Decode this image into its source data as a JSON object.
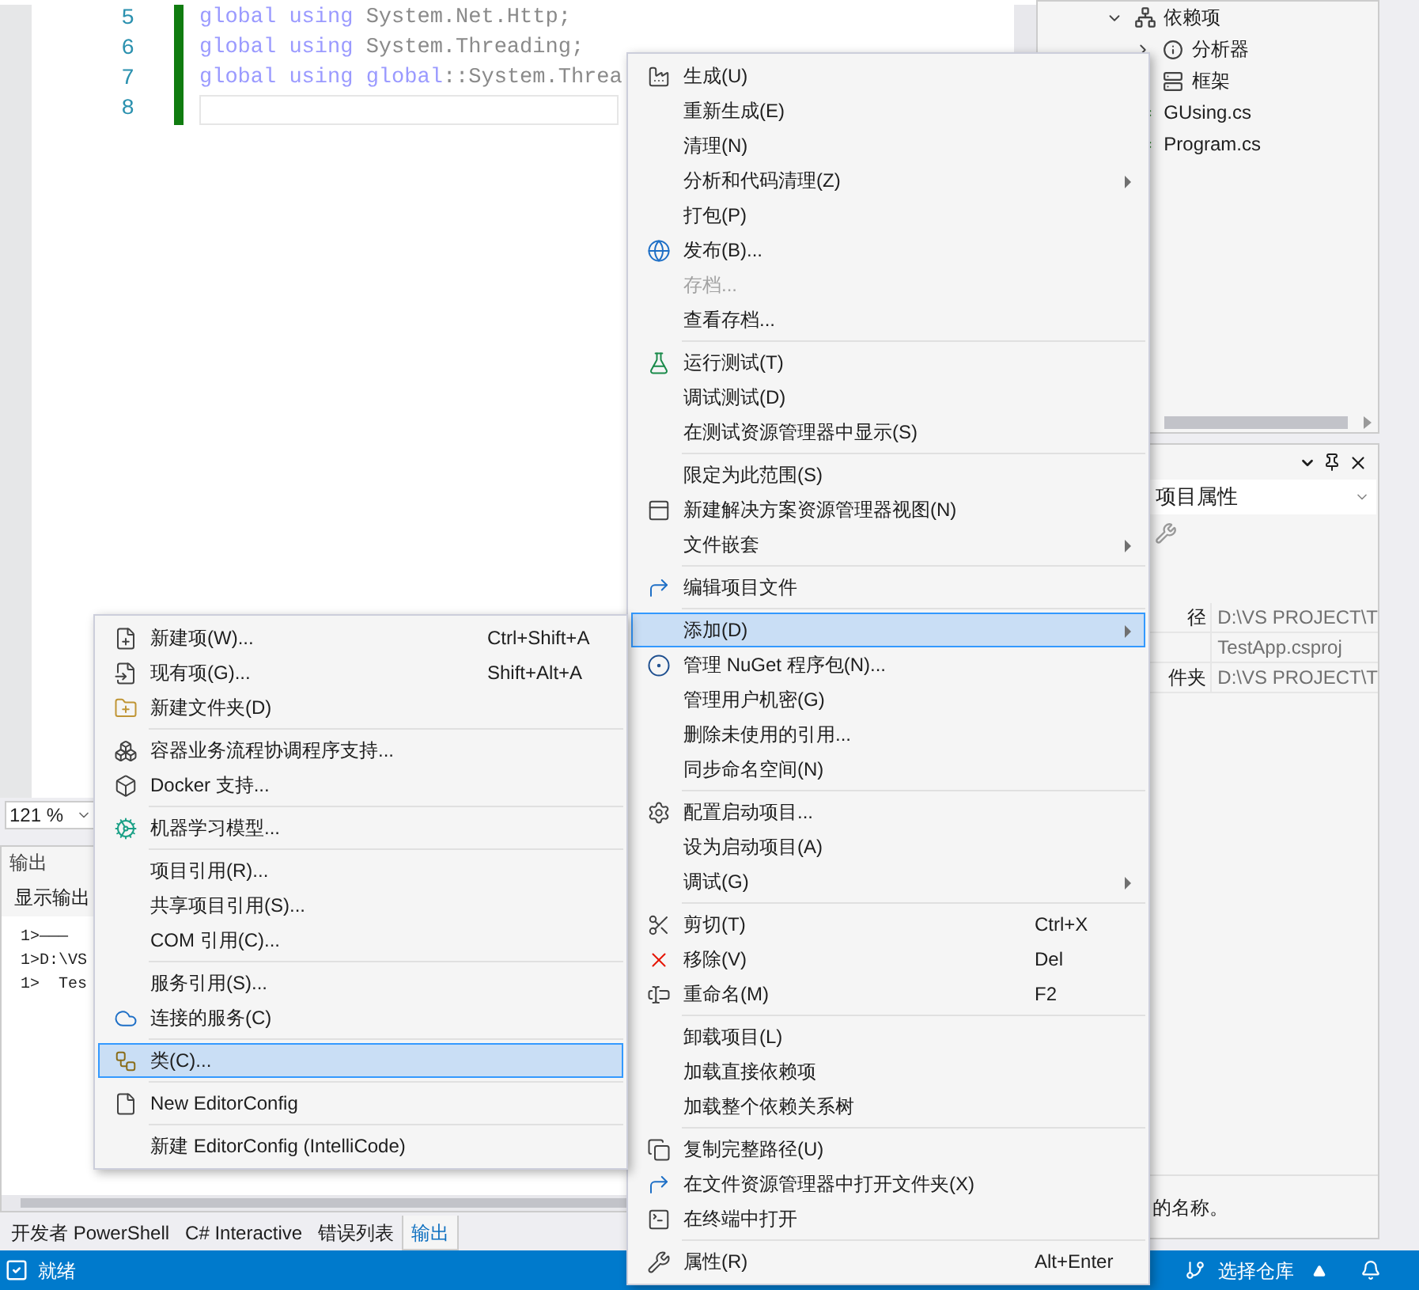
{
  "editor": {
    "lines": [
      {
        "number": "5",
        "current": false,
        "tokens": [
          {
            "text": "global using",
            "kind": "keyword"
          },
          {
            "text": " System.Net.Http;",
            "kind": "plain"
          }
        ]
      },
      {
        "number": "6",
        "current": false,
        "tokens": [
          {
            "text": "global using",
            "kind": "keyword"
          },
          {
            "text": " System.Threading;",
            "kind": "plain"
          }
        ]
      },
      {
        "number": "7",
        "current": false,
        "tokens": [
          {
            "text": "global using global",
            "kind": "keyword"
          },
          {
            "text": "::System.Threa",
            "kind": "plain"
          }
        ]
      },
      {
        "number": "8",
        "current": true
      }
    ],
    "zoom": "121 %"
  },
  "output": {
    "title": "输出",
    "toolbar_label": "显示输出",
    "lines": [
      "1>———",
      "1>D:\\VS",
      "1>  Tes"
    ]
  },
  "bottom_tabs": [
    {
      "label": "开发者 PowerShell",
      "selected": false
    },
    {
      "label": "C# Interactive",
      "selected": false
    },
    {
      "label": "错误列表",
      "selected": false
    },
    {
      "label": "输出",
      "selected": true
    }
  ],
  "solution_explorer": {
    "tree": [
      {
        "label": "依赖项",
        "expanded": true,
        "children": [
          {
            "label": "分析器",
            "expanded": false
          },
          {
            "label": "框架"
          }
        ]
      },
      {
        "label": "GUsing.cs"
      },
      {
        "label": "Program.cs"
      }
    ]
  },
  "properties": {
    "object": "项目属性",
    "rows": [
      {
        "name": "径",
        "value": "D:\\VS PROJECT\\T"
      },
      {
        "value": "TestApp.csproj"
      },
      {
        "name": "件夹",
        "value": "D:\\VS PROJECT\\T"
      }
    ],
    "description": "的名称。"
  },
  "status_bar": {
    "status": "就绪",
    "repository": "选择仓库"
  },
  "context_menu": {
    "groups": [
      [
        {
          "label": "生成(U)",
          "submenu": false,
          "disabled": false,
          "selected": false
        },
        {
          "label": "重新生成(E)",
          "submenu": false,
          "disabled": false,
          "selected": false
        },
        {
          "label": "清理(N)",
          "submenu": false,
          "disabled": false,
          "selected": false
        },
        {
          "label": "分析和代码清理(Z)",
          "submenu": true,
          "disabled": false,
          "selected": false
        },
        {
          "label": "打包(P)",
          "submenu": false,
          "disabled": false,
          "selected": false
        },
        {
          "label": "发布(B)...",
          "submenu": false,
          "disabled": false,
          "selected": false
        },
        {
          "label": "存档...",
          "submenu": false,
          "disabled": true,
          "selected": false
        },
        {
          "label": "查看存档...",
          "submenu": false,
          "disabled": false,
          "selected": false
        }
      ],
      [
        {
          "label": "运行测试(T)",
          "submenu": false,
          "disabled": false,
          "selected": false
        },
        {
          "label": "调试测试(D)",
          "submenu": false,
          "disabled": false,
          "selected": false
        },
        {
          "label": "在测试资源管理器中显示(S)",
          "submenu": false,
          "disabled": false,
          "selected": false
        }
      ],
      [
        {
          "label": "限定为此范围(S)",
          "submenu": false,
          "disabled": false,
          "selected": false
        },
        {
          "label": "新建解决方案资源管理器视图(N)",
          "submenu": false,
          "disabled": false,
          "selected": false
        },
        {
          "label": "文件嵌套",
          "submenu": true,
          "disabled": false,
          "selected": false
        }
      ],
      [
        {
          "label": "编辑项目文件",
          "submenu": false,
          "disabled": false,
          "selected": false
        }
      ],
      [
        {
          "label": "添加(D)",
          "submenu": true,
          "disabled": false,
          "selected": true
        },
        {
          "label": "管理 NuGet 程序包(N)...",
          "submenu": false,
          "disabled": false,
          "selected": false
        },
        {
          "label": "管理用户机密(G)",
          "submenu": false,
          "disabled": false,
          "selected": false
        },
        {
          "label": "删除未使用的引用...",
          "submenu": false,
          "disabled": false,
          "selected": false
        },
        {
          "label": "同步命名空间(N)",
          "submenu": false,
          "disabled": false,
          "selected": false
        }
      ],
      [
        {
          "label": "配置启动项目...",
          "submenu": false,
          "disabled": false,
          "selected": false
        },
        {
          "label": "设为启动项目(A)",
          "submenu": false,
          "disabled": false,
          "selected": false
        },
        {
          "label": "调试(G)",
          "submenu": true,
          "disabled": false,
          "selected": false
        }
      ],
      [
        {
          "label": "剪切(T)",
          "shortcut": "Ctrl+X",
          "submenu": false,
          "disabled": false,
          "selected": false
        },
        {
          "label": "移除(V)",
          "shortcut": "Del",
          "submenu": false,
          "disabled": false,
          "selected": false
        },
        {
          "label": "重命名(M)",
          "shortcut": "F2",
          "submenu": false,
          "disabled": false,
          "selected": false
        }
      ],
      [
        {
          "label": "卸载项目(L)",
          "submenu": false,
          "disabled": false,
          "selected": false
        },
        {
          "label": "加载直接依赖项",
          "submenu": false,
          "disabled": false,
          "selected": false
        },
        {
          "label": "加载整个依赖关系树",
          "submenu": false,
          "disabled": false,
          "selected": false
        }
      ],
      [
        {
          "label": "复制完整路径(U)",
          "submenu": false,
          "disabled": false,
          "selected": false
        },
        {
          "label": "在文件资源管理器中打开文件夹(X)",
          "submenu": false,
          "disabled": false,
          "selected": false
        },
        {
          "label": "在终端中打开",
          "submenu": false,
          "disabled": false,
          "selected": false
        }
      ],
      [
        {
          "label": "属性(R)",
          "shortcut": "Alt+Enter",
          "submenu": false,
          "disabled": false,
          "selected": false
        }
      ]
    ]
  },
  "add_submenu": {
    "groups": [
      [
        {
          "label": "新建项(W)...",
          "shortcut": "Ctrl+Shift+A",
          "selected": false
        },
        {
          "label": "现有项(G)...",
          "shortcut": "Shift+Alt+A",
          "selected": false
        },
        {
          "label": "新建文件夹(D)",
          "selected": false
        }
      ],
      [
        {
          "label": "容器业务流程协调程序支持...",
          "selected": false
        },
        {
          "label": "Docker 支持...",
          "selected": false
        }
      ],
      [
        {
          "label": "机器学习模型...",
          "selected": false
        }
      ],
      [
        {
          "label": "项目引用(R)...",
          "selected": false
        },
        {
          "label": "共享项目引用(S)...",
          "selected": false
        },
        {
          "label": "COM 引用(C)...",
          "selected": false
        }
      ],
      [
        {
          "label": "服务引用(S)...",
          "selected": false
        },
        {
          "label": "连接的服务(C)",
          "selected": false
        }
      ],
      [
        {
          "label": "类(C)...",
          "selected": true
        }
      ],
      [
        {
          "label": "New EditorConfig",
          "selected": false
        }
      ],
      [
        {
          "label": "新建 EditorConfig (IntelliCode)",
          "selected": false
        }
      ]
    ]
  }
}
